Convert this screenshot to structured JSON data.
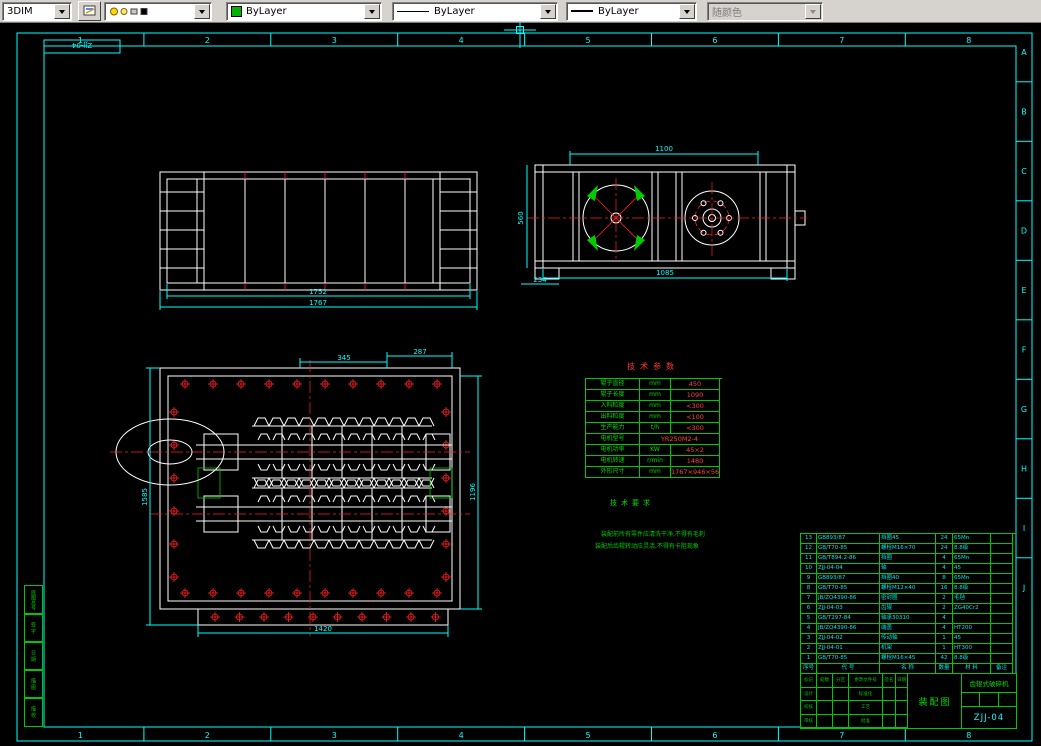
{
  "toolbar": {
    "dim_combo": "3DIM",
    "layer_combo": "",
    "color_combo": "ByLayer",
    "linetype_combo": "ByLayer",
    "lineweight_combo": "ByLayer",
    "plotstyle_combo": "随颜色"
  },
  "frame": {
    "code_label": "ZJJ-04",
    "zone_numbers": [
      "1",
      "2",
      "3",
      "4",
      "5",
      "6",
      "7",
      "8"
    ],
    "zone_letters": [
      "A",
      "B",
      "C",
      "D",
      "E",
      "F",
      "G",
      "H",
      "I",
      "J"
    ]
  },
  "views": {
    "top_view": {
      "dim_inner": "1752",
      "dim_outer": "1767"
    },
    "side_view": {
      "dim_top": "1100",
      "dim_bottom": "1085",
      "dim_left": "560",
      "dim_foot": "234"
    },
    "plan_view": {
      "dim_a": "345",
      "dim_b": "287",
      "dim_width": "1420",
      "dim_height_right": "1196",
      "dim_height_left": "1585"
    }
  },
  "tech_params": {
    "title": "技术参数",
    "rows": [
      {
        "label": "辊子直径",
        "unit": "mm",
        "value": "450"
      },
      {
        "label": "辊子长度",
        "unit": "mm",
        "value": "1090"
      },
      {
        "label": "入料粒度",
        "unit": "mm",
        "value": "<300"
      },
      {
        "label": "出料粒度",
        "unit": "mm",
        "value": "<100"
      },
      {
        "label": "生产能力",
        "unit": "t/h",
        "value": "<300"
      },
      {
        "label": "电机型号",
        "value": "YR250M2-4",
        "span": true
      },
      {
        "label": "电机功率",
        "unit": "KW",
        "value": "45×2"
      },
      {
        "label": "电机转速",
        "unit": "r/min",
        "value": "1480"
      },
      {
        "label": "外形尺寸",
        "unit": "mm",
        "value": "1767×946×560"
      }
    ]
  },
  "tech_notes": {
    "title": "技术要求",
    "lines": [
      "装配前所有零件应清洗干净,不得有毛刺",
      "装配后齿辊转动应灵活,不得有卡阻现象"
    ]
  },
  "bom": {
    "header": [
      "序号",
      "代  号",
      "名  称",
      "数量",
      "材  料",
      "备注"
    ],
    "rows": [
      [
        "13",
        "GB893/87",
        "挡圈45",
        "24",
        "65Mn",
        ""
      ],
      [
        "12",
        "GB/T70-85",
        "螺栓M16×70",
        "24",
        "8.8级",
        ""
      ],
      [
        "11",
        "GB/T894.2-86",
        "挡圈",
        "4",
        "65Mn",
        ""
      ],
      [
        "10",
        "ZJJ-04-04",
        "轴",
        "4",
        "45",
        ""
      ],
      [
        "9",
        "GB893/87",
        "挡圈40",
        "8",
        "65Mn",
        ""
      ],
      [
        "8",
        "GB/T70-85",
        "螺栓M12×40",
        "16",
        "8.8级",
        ""
      ],
      [
        "7",
        "JB/ZQ4390-86",
        "密封圈",
        "2",
        "毛毡",
        ""
      ],
      [
        "6",
        "ZJJ-04-03",
        "齿辊",
        "2",
        "ZG40Cr2",
        ""
      ],
      [
        "5",
        "GB/T297-84",
        "轴承30310",
        "4",
        "",
        ""
      ],
      [
        "4",
        "JB/ZQ4390-86",
        "端盖",
        "4",
        "HT200",
        ""
      ],
      [
        "3",
        "ZJJ-04-02",
        "传动轴",
        "1",
        "45",
        ""
      ],
      [
        "2",
        "ZJJ-04-01",
        "机架",
        "1",
        "HT300",
        ""
      ],
      [
        "1",
        "GB/T70-85",
        "螺栓M16×45",
        "42",
        "8.8级",
        ""
      ]
    ]
  },
  "title_block": {
    "left_rows": [
      [
        "标记",
        "处数",
        "分区",
        "更改文件号",
        "签名",
        "日期"
      ],
      [
        "设计",
        "",
        "",
        "标准化",
        "",
        ""
      ],
      [
        "校核",
        "",
        "",
        "工艺",
        "",
        ""
      ],
      [
        "审核",
        "",
        "",
        "批准",
        "",
        ""
      ]
    ],
    "view_name": "装配图",
    "product_name": "齿辊式破碎机",
    "drawing_no": "ZJJ-04"
  },
  "margin_column": [
    "底图总号",
    "签 字",
    "日 期",
    "描 图",
    "描 校"
  ]
}
